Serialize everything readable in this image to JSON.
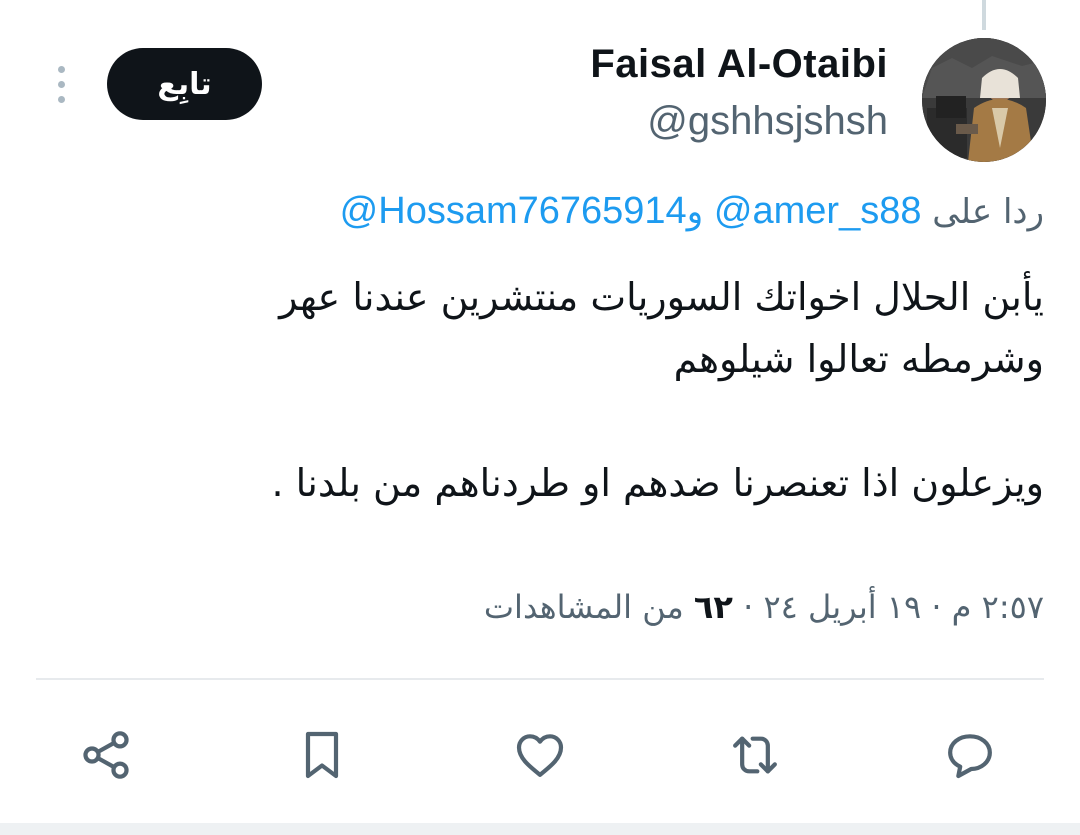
{
  "tweet": {
    "author_name": "Faisal Al-Otaibi",
    "author_handle": "@gshhsjshsh",
    "follow_label": "تابِع",
    "reply_prefix": "ردا على",
    "reply_mention_1": "@amer_s88",
    "reply_conjunction": "و",
    "reply_mention_2": "@Hossam76765914",
    "text_lines": [
      "يأبن الحلال اخواتك السوريات منتشرين عندنا عهر",
      "وشرمطه تعالوا شيلوهم",
      "ويزعلون اذا تعنصرنا ضدهم او طردناهم من بلدنا ."
    ],
    "time": "٢:٥٧ م",
    "date": "١٩ أبريل ٢٤",
    "views_count": "٦٢",
    "views_label": "من المشاهدات",
    "separator": "·"
  },
  "actions": {
    "reply_icon": "speech-bubble-icon",
    "retweet_icon": "retweet-arrows-icon",
    "like_icon": "heart-icon",
    "bookmark_icon": "bookmark-icon",
    "share_icon": "share-nodes-icon"
  },
  "colors": {
    "text": "#0f1419",
    "secondary": "#536471",
    "link": "#1d9bf0",
    "button_bg": "#0f1419",
    "divider": "#e7eaed"
  }
}
